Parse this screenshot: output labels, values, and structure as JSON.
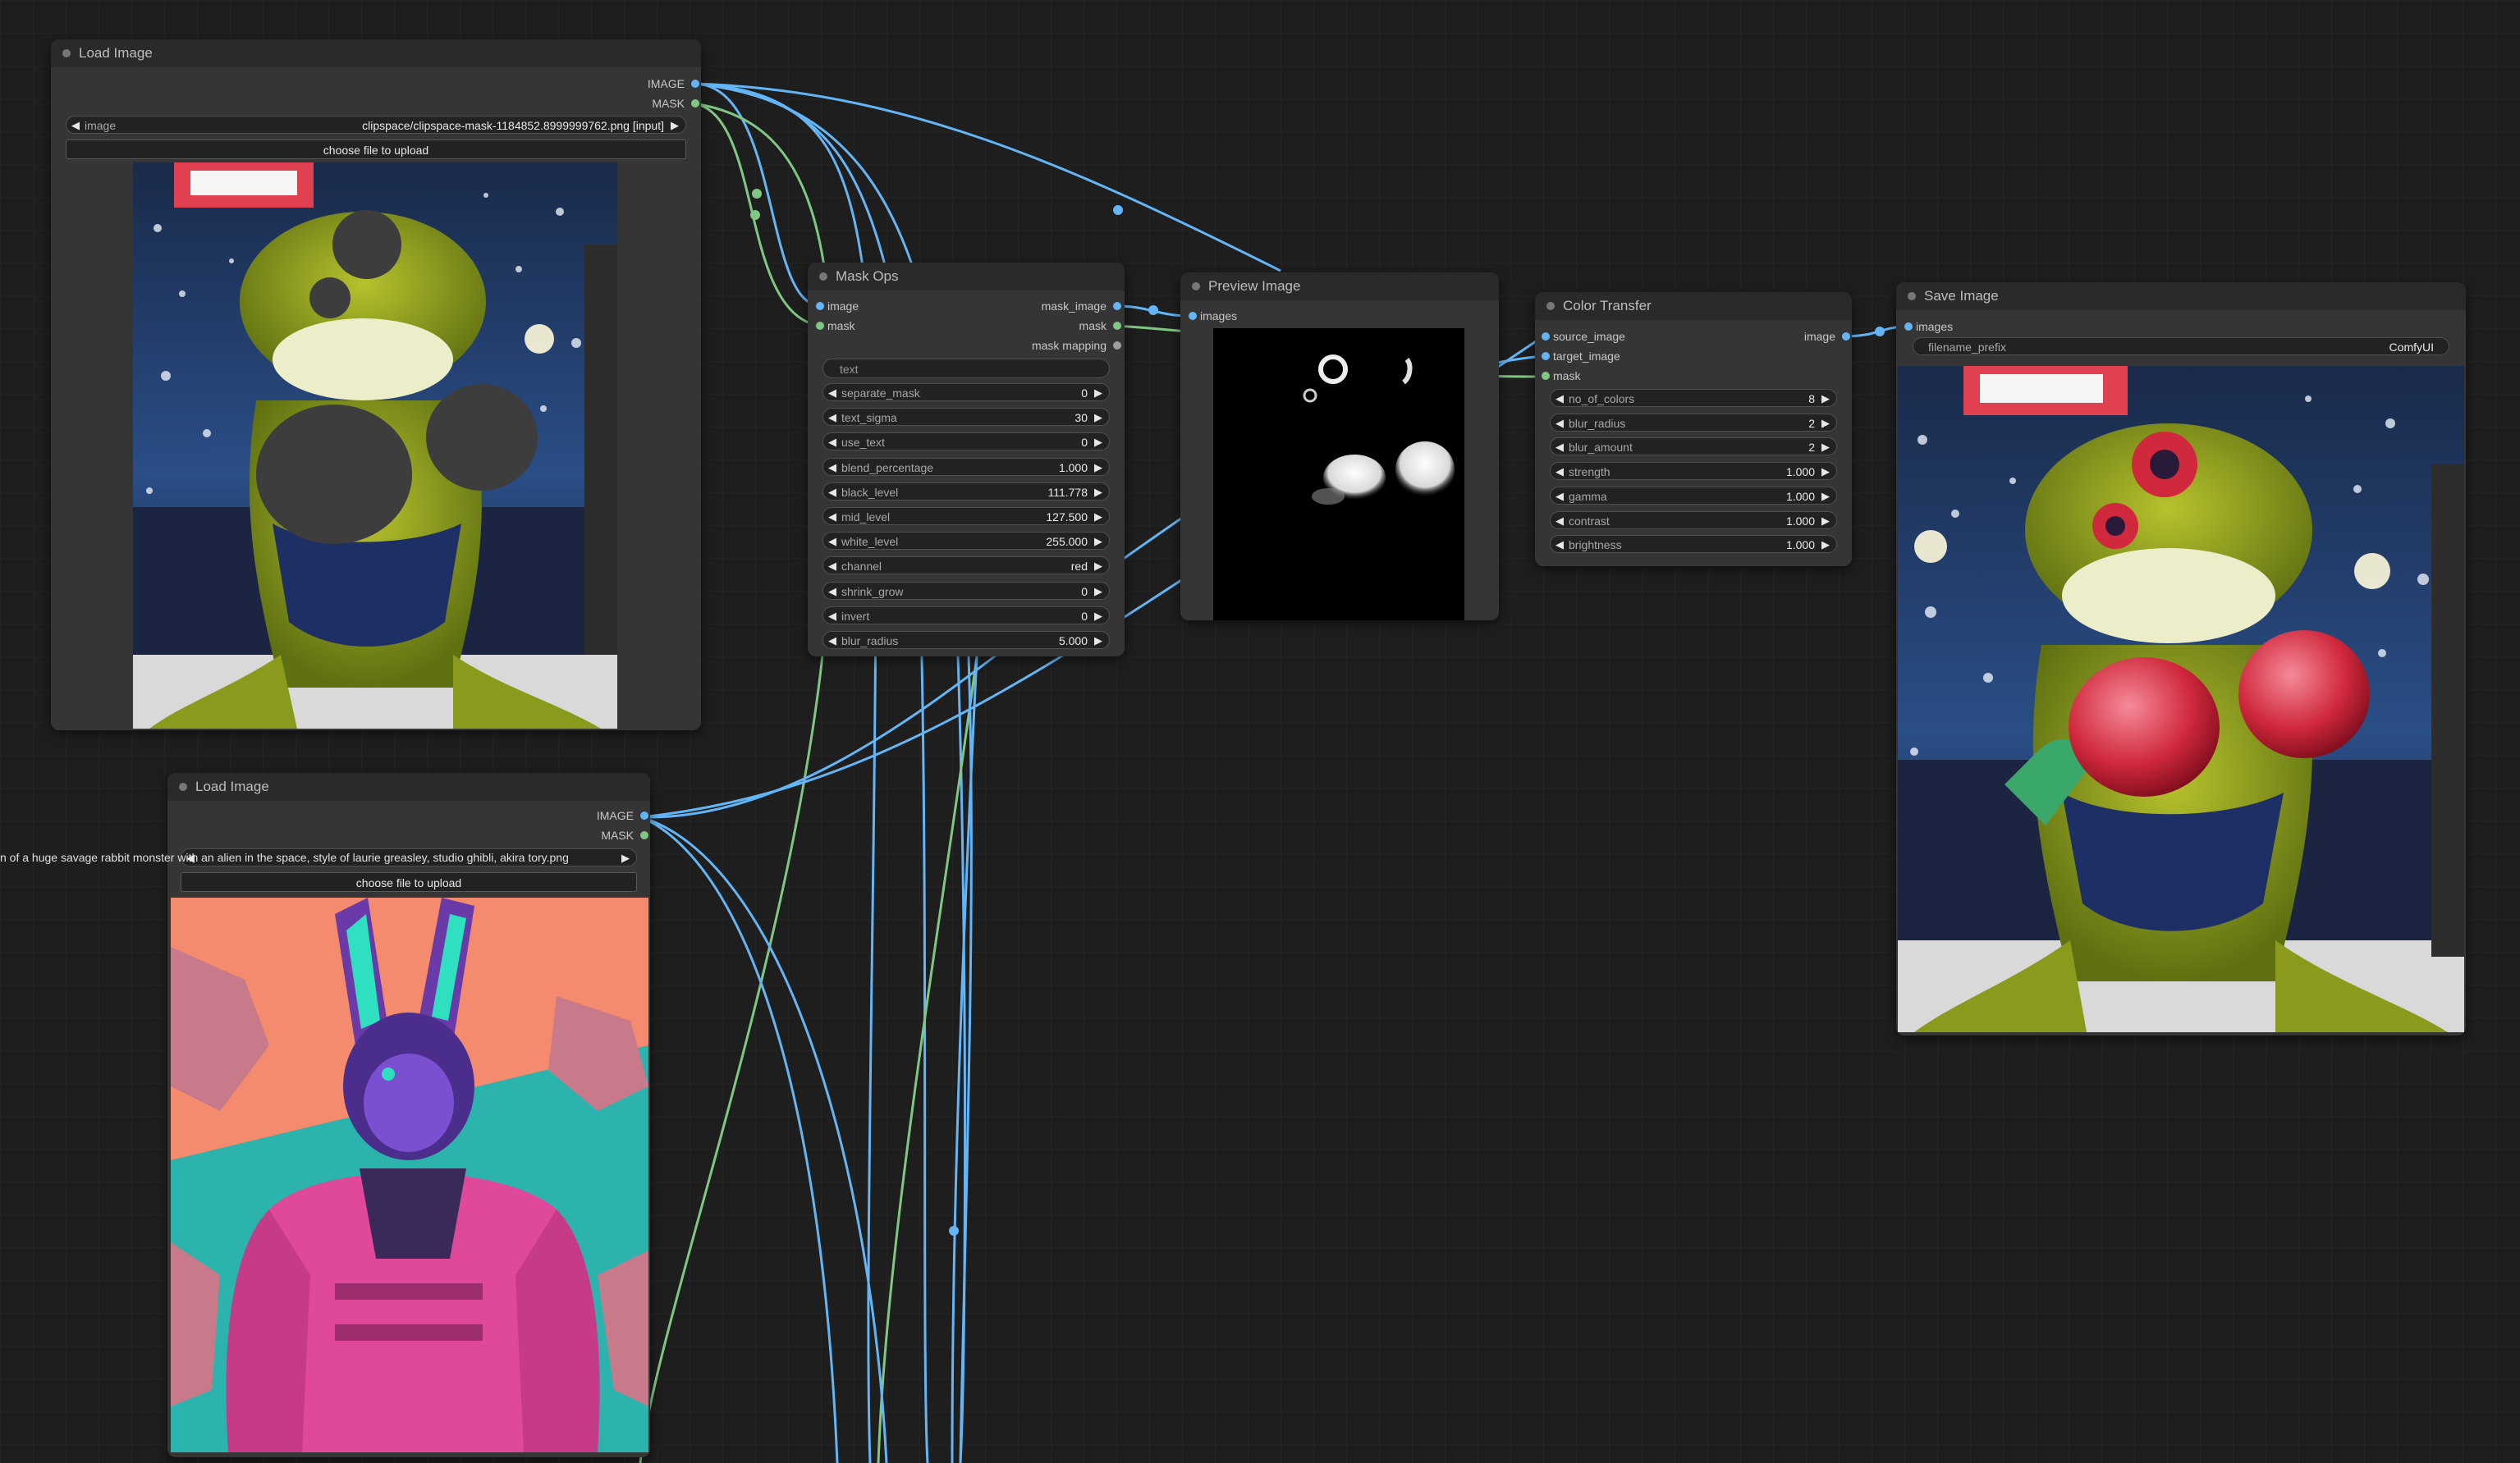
{
  "nodes": {
    "load1": {
      "title": "Load Image",
      "out_image": "IMAGE",
      "out_mask": "MASK",
      "widget_label": "image",
      "widget_value": "clipspace/clipspace-mask-1184852.8999999762.png [input]",
      "upload": "choose file to upload"
    },
    "load2": {
      "title": "Load Image",
      "out_image": "IMAGE",
      "out_mask": "MASK",
      "widget_value": "n of a huge savage rabbit monster with an alien in the space, style of laurie greasley, studio ghibli, akira tory.png",
      "upload": "choose file to upload"
    },
    "maskops": {
      "title": "Mask Ops",
      "in_image": "image",
      "in_mask": "mask",
      "out_mask_image": "mask_image",
      "out_mask": "mask",
      "out_mask_mapping": "mask mapping",
      "text_placeholder": "text",
      "widgets": [
        {
          "label": "separate_mask",
          "value": "0"
        },
        {
          "label": "text_sigma",
          "value": "30"
        },
        {
          "label": "use_text",
          "value": "0"
        },
        {
          "label": "blend_percentage",
          "value": "1.000"
        },
        {
          "label": "black_level",
          "value": "111.778"
        },
        {
          "label": "mid_level",
          "value": "127.500"
        },
        {
          "label": "white_level",
          "value": "255.000"
        },
        {
          "label": "channel",
          "value": "red"
        },
        {
          "label": "shrink_grow",
          "value": "0"
        },
        {
          "label": "invert",
          "value": "0"
        },
        {
          "label": "blur_radius",
          "value": "5.000"
        }
      ]
    },
    "preview": {
      "title": "Preview Image",
      "in_images": "images"
    },
    "colortransfer": {
      "title": "Color Transfer",
      "in_source": "source_image",
      "in_target": "target_image",
      "in_mask": "mask",
      "out_image": "image",
      "widgets": [
        {
          "label": "no_of_colors",
          "value": "8"
        },
        {
          "label": "blur_radius",
          "value": "2"
        },
        {
          "label": "blur_amount",
          "value": "2"
        },
        {
          "label": "strength",
          "value": "1.000"
        },
        {
          "label": "gamma",
          "value": "1.000"
        },
        {
          "label": "contrast",
          "value": "1.000"
        },
        {
          "label": "brightness",
          "value": "1.000"
        }
      ]
    },
    "save": {
      "title": "Save Image",
      "in_images": "images",
      "widget_label": "filename_prefix",
      "widget_value": "ComfyUI"
    }
  },
  "colors": {
    "canvas": "#1e1e1e",
    "node_body": "#353535",
    "node_header": "#2a2a2a",
    "wire_image": "#64b5f6",
    "wire_mask": "#81c784"
  }
}
